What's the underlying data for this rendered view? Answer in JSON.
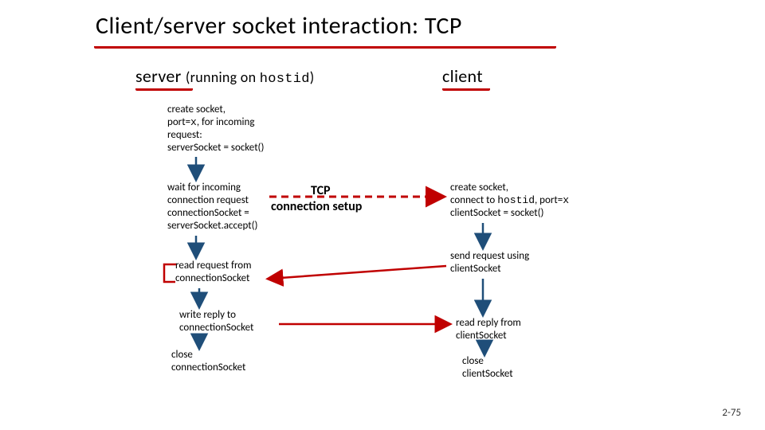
{
  "title": "Client/server socket interaction: TCP",
  "server_heading": {
    "main": "server",
    "sub": "(running on ",
    "hostid": "hostid",
    "close": ")"
  },
  "client_heading": "client",
  "server_steps": {
    "create": {
      "l1": "create socket,",
      "l2_a": "port=",
      "l2_b": "x",
      "l2_c": ", for incoming",
      "l3": "request:",
      "l4": "serverSocket = socket()"
    },
    "wait": {
      "l1": "wait for incoming",
      "l2": "connection request",
      "l3": "connectionSocket =",
      "l4": "serverSocket.accept()"
    },
    "read": {
      "l1": "read request from",
      "l2": "connectionSocket"
    },
    "write": {
      "l1": "write reply to",
      "l2": "connectionSocket"
    },
    "close": {
      "l1": "close",
      "l2": "connectionSocket"
    }
  },
  "tcp": {
    "l1": "TCP",
    "l2": "connection setup"
  },
  "client_steps": {
    "create": {
      "l1": "create socket,",
      "l2_a": "connect to ",
      "l2_b": "hostid",
      "l2_c": ", port=",
      "l2_d": "x",
      "l3": "clientSocket = socket()"
    },
    "send": {
      "l1": "send request using",
      "l2": "clientSocket"
    },
    "read": {
      "l1": "read reply from",
      "l2": "clientSocket"
    },
    "close": {
      "l1": "close",
      "l2": "clientSocket"
    }
  },
  "page": "2-75"
}
